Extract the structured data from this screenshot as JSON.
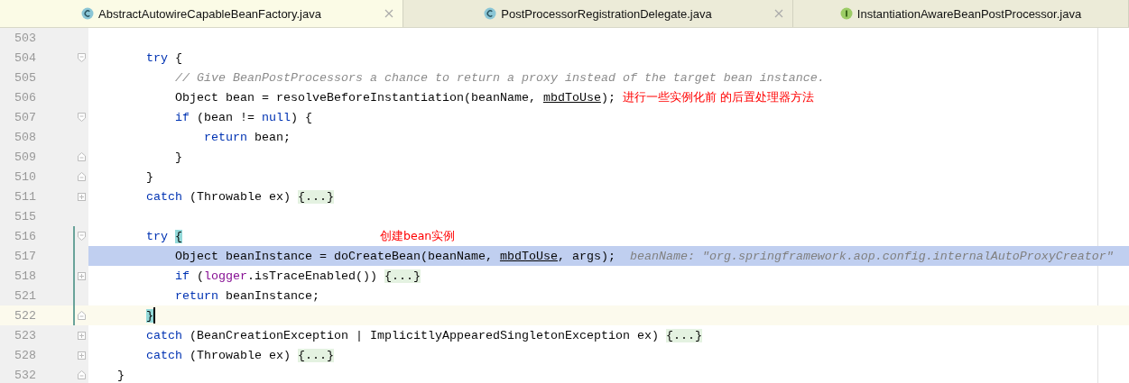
{
  "tabs": [
    {
      "label": "AbstractAutowireCapableBeanFactory.java",
      "kind": "class",
      "selected": true,
      "closable": true
    },
    {
      "label": "PostProcessorRegistrationDelegate.java",
      "kind": "class",
      "selected": false,
      "closable": true
    },
    {
      "label": "InstantiationAwareBeanPostProcessor.java",
      "kind": "interface",
      "selected": false,
      "closable": false
    }
  ],
  "lines": [
    {
      "number": "503",
      "kind": "plain",
      "changed": false,
      "selected": false,
      "caret": false
    },
    {
      "number": "504",
      "kind": "block_start",
      "changed": false,
      "selected": false,
      "caret": false,
      "segments": [
        {
          "kind": "keyword",
          "text": "try"
        },
        {
          "kind": "plain",
          "text": " {"
        }
      ]
    },
    {
      "number": "505",
      "kind": "plain",
      "changed": false,
      "selected": false,
      "caret": false,
      "segments": [
        {
          "kind": "comment",
          "text": "// Give BeanPostProcessors a chance to return a proxy instead of the target bean instance."
        }
      ]
    },
    {
      "number": "506",
      "kind": "plain",
      "changed": false,
      "selected": false,
      "caret": false,
      "segments": [
        {
          "kind": "plain",
          "text": "Object bean = resolveBeforeInstantiation(beanName, "
        },
        {
          "kind": "param",
          "text": "mbdToUse"
        },
        {
          "kind": "plain",
          "text": ");"
        },
        {
          "kind": "note",
          "text": "进行一些实例化前 的后置处理器方法"
        }
      ]
    },
    {
      "number": "507",
      "kind": "block_start",
      "changed": false,
      "selected": false,
      "caret": false,
      "segments": [
        {
          "kind": "keyword",
          "text": "if"
        },
        {
          "kind": "plain",
          "text": " (bean != "
        },
        {
          "kind": "keyword",
          "text": "null"
        },
        {
          "kind": "plain",
          "text": ") {"
        }
      ]
    },
    {
      "number": "508",
      "kind": "plain",
      "changed": false,
      "selected": false,
      "caret": false,
      "segments": [
        {
          "kind": "keyword",
          "text": "return"
        },
        {
          "kind": "plain",
          "text": " bean;"
        }
      ]
    },
    {
      "number": "509",
      "kind": "block_end",
      "changed": false,
      "selected": false,
      "caret": false,
      "segments": [
        {
          "kind": "plain",
          "text": "}"
        }
      ]
    },
    {
      "number": "510",
      "kind": "block_end",
      "changed": false,
      "selected": false,
      "caret": false,
      "segments": [
        {
          "kind": "plain",
          "text": "}"
        }
      ]
    },
    {
      "number": "511",
      "kind": "collapsed",
      "changed": false,
      "selected": false,
      "caret": false,
      "segments": [
        {
          "kind": "keyword",
          "text": "catch"
        },
        {
          "kind": "plain",
          "text": " (Throwable ex) "
        },
        {
          "kind": "folded",
          "text": "{...}"
        }
      ]
    },
    {
      "number": "515",
      "kind": "plain",
      "changed": false,
      "selected": false,
      "caret": false
    },
    {
      "number": "516",
      "kind": "block_start",
      "changed": true,
      "selected": false,
      "caret": false,
      "segments": [
        {
          "kind": "keyword",
          "text": "try "
        },
        {
          "kind": "brace_match",
          "text": "{"
        },
        {
          "kind": "note",
          "text": "创建bean实例"
        }
      ]
    },
    {
      "number": "517",
      "kind": "plain",
      "changed": true,
      "selected": true,
      "caret": false,
      "segments": [
        {
          "kind": "plain",
          "text": "Object beanInstance = doCreateBean(beanName, "
        },
        {
          "kind": "param",
          "text": "mbdToUse"
        },
        {
          "kind": "plain",
          "text": ", args);"
        },
        {
          "kind": "hint",
          "text": "beanName: \"org.springframework.aop.config.internalAutoProxyCreator\""
        }
      ]
    },
    {
      "number": "518",
      "kind": "collapsed",
      "changed": true,
      "selected": false,
      "caret": false,
      "segments": [
        {
          "kind": "keyword",
          "text": "if"
        },
        {
          "kind": "plain",
          "text": " ("
        },
        {
          "kind": "field",
          "text": "logger"
        },
        {
          "kind": "plain",
          "text": ".isTraceEnabled()) "
        },
        {
          "kind": "folded",
          "text": "{...}"
        }
      ]
    },
    {
      "number": "521",
      "kind": "plain",
      "changed": true,
      "selected": false,
      "caret": false,
      "segments": [
        {
          "kind": "keyword",
          "text": "return"
        },
        {
          "kind": "plain",
          "text": " beanInstance;"
        }
      ]
    },
    {
      "number": "522",
      "kind": "block_end",
      "changed": true,
      "selected": false,
      "caret": true,
      "segments": [
        {
          "kind": "brace_match",
          "text": "}"
        }
      ]
    },
    {
      "number": "523",
      "kind": "collapsed",
      "changed": false,
      "selected": false,
      "caret": false,
      "segments": [
        {
          "kind": "keyword",
          "text": "catch"
        },
        {
          "kind": "plain",
          "text": " (BeanCreationException | ImplicitlyAppearedSingletonException ex) "
        },
        {
          "kind": "folded",
          "text": "{...}"
        }
      ]
    },
    {
      "number": "528",
      "kind": "collapsed",
      "changed": false,
      "selected": false,
      "caret": false,
      "segments": [
        {
          "kind": "keyword",
          "text": "catch"
        },
        {
          "kind": "plain",
          "text": " (Throwable ex) "
        },
        {
          "kind": "folded",
          "text": "{...}"
        }
      ]
    },
    {
      "number": "532",
      "kind": "block_end",
      "changed": false,
      "selected": false,
      "caret": false,
      "segments": [
        {
          "kind": "plain",
          "text": "}"
        }
      ]
    }
  ]
}
